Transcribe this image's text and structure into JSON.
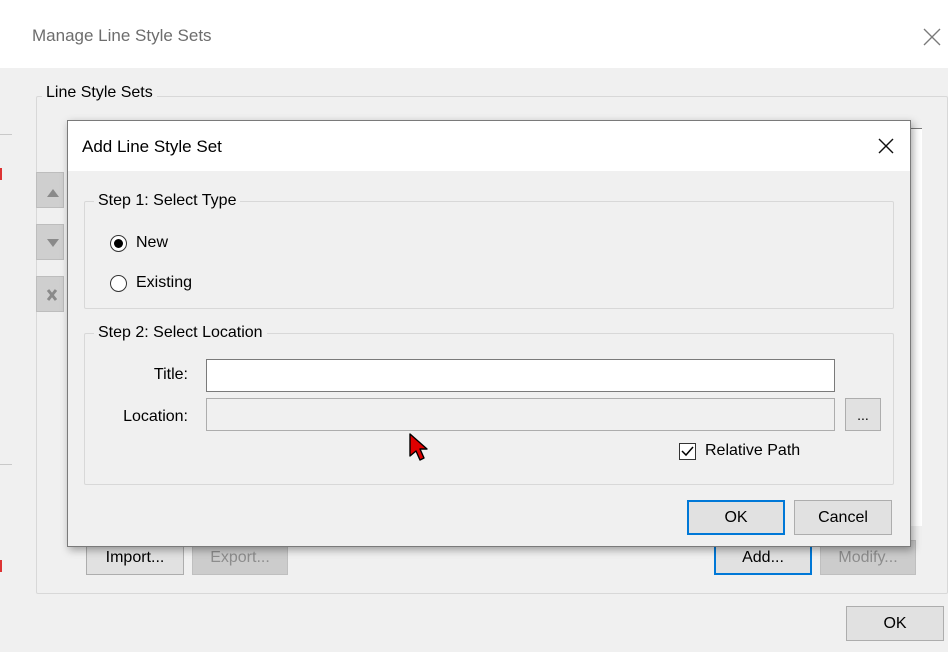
{
  "outer": {
    "title": "Manage Line Style Sets",
    "group_label": "Line Style Sets",
    "side_buttons": [
      "up-arrow-icon",
      "down-arrow-icon",
      "delete-icon"
    ],
    "import_label": "Import...",
    "export_label": "Export...",
    "add_label": "Add...",
    "modify_label": "Modify...",
    "ok_label": "OK"
  },
  "dialog": {
    "title": "Add Line Style Set",
    "step1": {
      "label": "Step 1: Select Type",
      "options": [
        {
          "label": "New",
          "selected": true
        },
        {
          "label": "Existing",
          "selected": false
        }
      ]
    },
    "step2": {
      "label": "Step 2: Select Location",
      "title_label": "Title:",
      "title_value": "",
      "location_label": "Location:",
      "location_value": "",
      "browse_label": "...",
      "relative_path_label": "Relative Path",
      "relative_path_checked": true
    },
    "ok_label": "OK",
    "cancel_label": "Cancel"
  },
  "colors": {
    "accent": "#0078d7",
    "window_bg": "#f0f0f0",
    "cursor": "#e00000"
  }
}
